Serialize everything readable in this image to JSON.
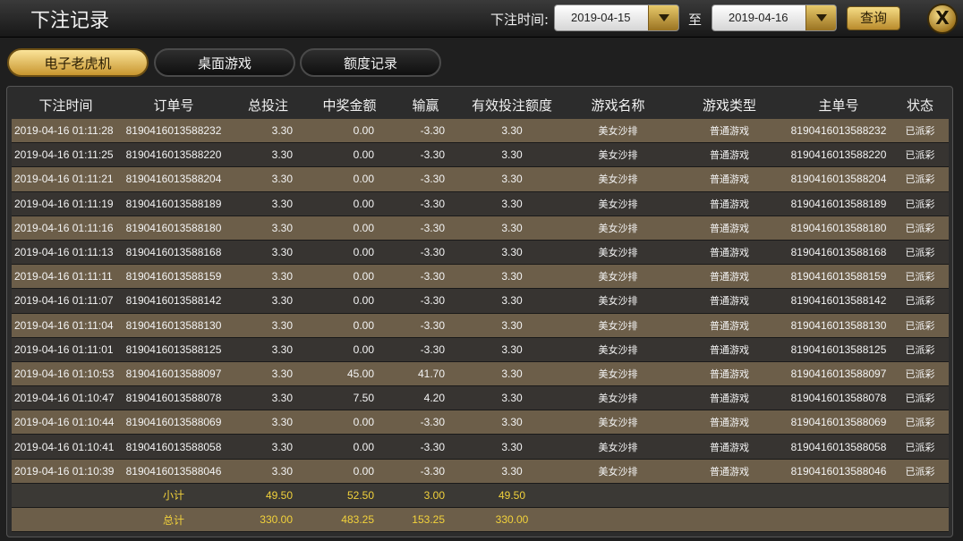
{
  "header": {
    "title": "下注记录",
    "filter_label": "下注时间:",
    "start_date": "2019-04-15",
    "to_label": "至",
    "end_date": "2019-04-16",
    "query_label": "查询",
    "close_label": "X"
  },
  "tabs": [
    {
      "label": "电子老虎机",
      "active": true
    },
    {
      "label": "桌面游戏",
      "active": false
    },
    {
      "label": "额度记录",
      "active": false
    }
  ],
  "columns": [
    "下注时间",
    "订单号",
    "总投注",
    "中奖金额",
    "输赢",
    "有效投注额度",
    "游戏名称",
    "游戏类型",
    "主单号",
    "状态"
  ],
  "rows": [
    [
      "2019-04-16 01:11:28",
      "8190416013588232",
      "3.30",
      "0.00",
      "-3.30",
      "3.30",
      "美女沙排",
      "普通游戏",
      "8190416013588232",
      "已派彩"
    ],
    [
      "2019-04-16 01:11:25",
      "8190416013588220",
      "3.30",
      "0.00",
      "-3.30",
      "3.30",
      "美女沙排",
      "普通游戏",
      "8190416013588220",
      "已派彩"
    ],
    [
      "2019-04-16 01:11:21",
      "8190416013588204",
      "3.30",
      "0.00",
      "-3.30",
      "3.30",
      "美女沙排",
      "普通游戏",
      "8190416013588204",
      "已派彩"
    ],
    [
      "2019-04-16 01:11:19",
      "8190416013588189",
      "3.30",
      "0.00",
      "-3.30",
      "3.30",
      "美女沙排",
      "普通游戏",
      "8190416013588189",
      "已派彩"
    ],
    [
      "2019-04-16 01:11:16",
      "8190416013588180",
      "3.30",
      "0.00",
      "-3.30",
      "3.30",
      "美女沙排",
      "普通游戏",
      "8190416013588180",
      "已派彩"
    ],
    [
      "2019-04-16 01:11:13",
      "8190416013588168",
      "3.30",
      "0.00",
      "-3.30",
      "3.30",
      "美女沙排",
      "普通游戏",
      "8190416013588168",
      "已派彩"
    ],
    [
      "2019-04-16 01:11:11",
      "8190416013588159",
      "3.30",
      "0.00",
      "-3.30",
      "3.30",
      "美女沙排",
      "普通游戏",
      "8190416013588159",
      "已派彩"
    ],
    [
      "2019-04-16 01:11:07",
      "8190416013588142",
      "3.30",
      "0.00",
      "-3.30",
      "3.30",
      "美女沙排",
      "普通游戏",
      "8190416013588142",
      "已派彩"
    ],
    [
      "2019-04-16 01:11:04",
      "8190416013588130",
      "3.30",
      "0.00",
      "-3.30",
      "3.30",
      "美女沙排",
      "普通游戏",
      "8190416013588130",
      "已派彩"
    ],
    [
      "2019-04-16 01:11:01",
      "8190416013588125",
      "3.30",
      "0.00",
      "-3.30",
      "3.30",
      "美女沙排",
      "普通游戏",
      "8190416013588125",
      "已派彩"
    ],
    [
      "2019-04-16 01:10:53",
      "8190416013588097",
      "3.30",
      "45.00",
      "41.70",
      "3.30",
      "美女沙排",
      "普通游戏",
      "8190416013588097",
      "已派彩"
    ],
    [
      "2019-04-16 01:10:47",
      "8190416013588078",
      "3.30",
      "7.50",
      "4.20",
      "3.30",
      "美女沙排",
      "普通游戏",
      "8190416013588078",
      "已派彩"
    ],
    [
      "2019-04-16 01:10:44",
      "8190416013588069",
      "3.30",
      "0.00",
      "-3.30",
      "3.30",
      "美女沙排",
      "普通游戏",
      "8190416013588069",
      "已派彩"
    ],
    [
      "2019-04-16 01:10:41",
      "8190416013588058",
      "3.30",
      "0.00",
      "-3.30",
      "3.30",
      "美女沙排",
      "普通游戏",
      "8190416013588058",
      "已派彩"
    ],
    [
      "2019-04-16 01:10:39",
      "8190416013588046",
      "3.30",
      "0.00",
      "-3.30",
      "3.30",
      "美女沙排",
      "普通游戏",
      "8190416013588046",
      "已派彩"
    ]
  ],
  "subtotal": {
    "label": "小计",
    "bet": "49.50",
    "win": "52.50",
    "profit": "3.00",
    "valid": "49.50"
  },
  "total": {
    "label": "总计",
    "bet": "330.00",
    "win": "483.25",
    "profit": "153.25",
    "valid": "330.00"
  }
}
